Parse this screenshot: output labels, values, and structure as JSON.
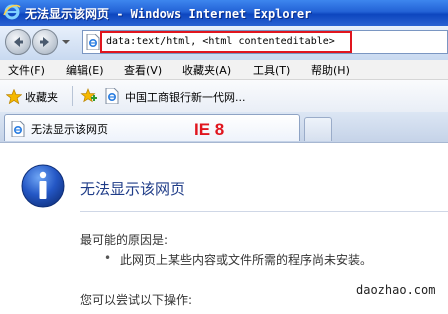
{
  "window": {
    "title": "无法显示该网页 - Windows Internet Explorer"
  },
  "address_bar": {
    "url": "data:text/html, <html contenteditable>"
  },
  "menu": {
    "items": [
      {
        "label": "文件(F)"
      },
      {
        "label": "编辑(E)"
      },
      {
        "label": "查看(V)"
      },
      {
        "label": "收藏夹(A)"
      },
      {
        "label": "工具(T)"
      },
      {
        "label": "帮助(H)"
      }
    ]
  },
  "favorites_bar": {
    "favorites_label": "收藏夹",
    "link_label": "中国工商银行新一代网..."
  },
  "tabs": {
    "active_label": "无法显示该网页"
  },
  "annotation": {
    "badge": "IE 8"
  },
  "error_page": {
    "title": "无法显示该网页",
    "reason_heading": "最可能的原因是:",
    "bullet": "•",
    "reason": "此网页上某些内容或文件所需的程序尚未安装。",
    "try_heading": "您可以尝试以下操作:"
  },
  "watermark": "daozhao.com",
  "colors": {
    "title_bar": "#2362d6",
    "highlight": "#e0151e",
    "error_title": "#1f3c88"
  }
}
